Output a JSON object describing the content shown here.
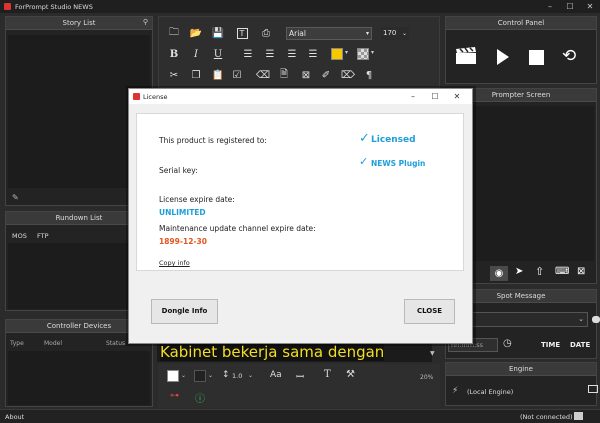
{
  "app": {
    "title": "ForPrompt Studio NEWS"
  },
  "story_list": {
    "title": "Story List"
  },
  "rundown_list": {
    "title": "Rundown List",
    "columns": [
      "MOS",
      "FTP"
    ]
  },
  "controller_devices": {
    "title": "Controller Devices",
    "columns": [
      "Type",
      "Model",
      "Status"
    ]
  },
  "toolbar": {
    "font_name": "Arial",
    "font_size": "170",
    "line_spacing": "1.0",
    "zoom": "20%",
    "highlight_color": "#f5c800"
  },
  "ticker": {
    "text": "Kabinet bekerja sama dengan"
  },
  "control_panel": {
    "title": "Control Panel"
  },
  "prompter_screen": {
    "title": "Prompter Screen"
  },
  "spot_message": {
    "title": "Spot Message",
    "time_placeholder": "hh:mm:ss",
    "time_label": "TIME",
    "date_label": "DATE"
  },
  "engine": {
    "title": "Engine",
    "local_engine": "(Local Engine)"
  },
  "status": {
    "about": "About",
    "connection": "(Not connected)"
  },
  "dialog": {
    "title": "License",
    "registered_to": "This product is registered to:",
    "serial_key": "Serial key:",
    "license_expire_label": "License expire date:",
    "license_expire_value": "UNLIMITED",
    "maintenance_label": "Maintenance update channel expire date:",
    "maintenance_value": "1899-12-30",
    "copy_info": "Copy info",
    "licensed": "Licensed",
    "news_plugin": "NEWS Plugin",
    "dongle_info": "Dongle Info",
    "close": "CLOSE"
  }
}
